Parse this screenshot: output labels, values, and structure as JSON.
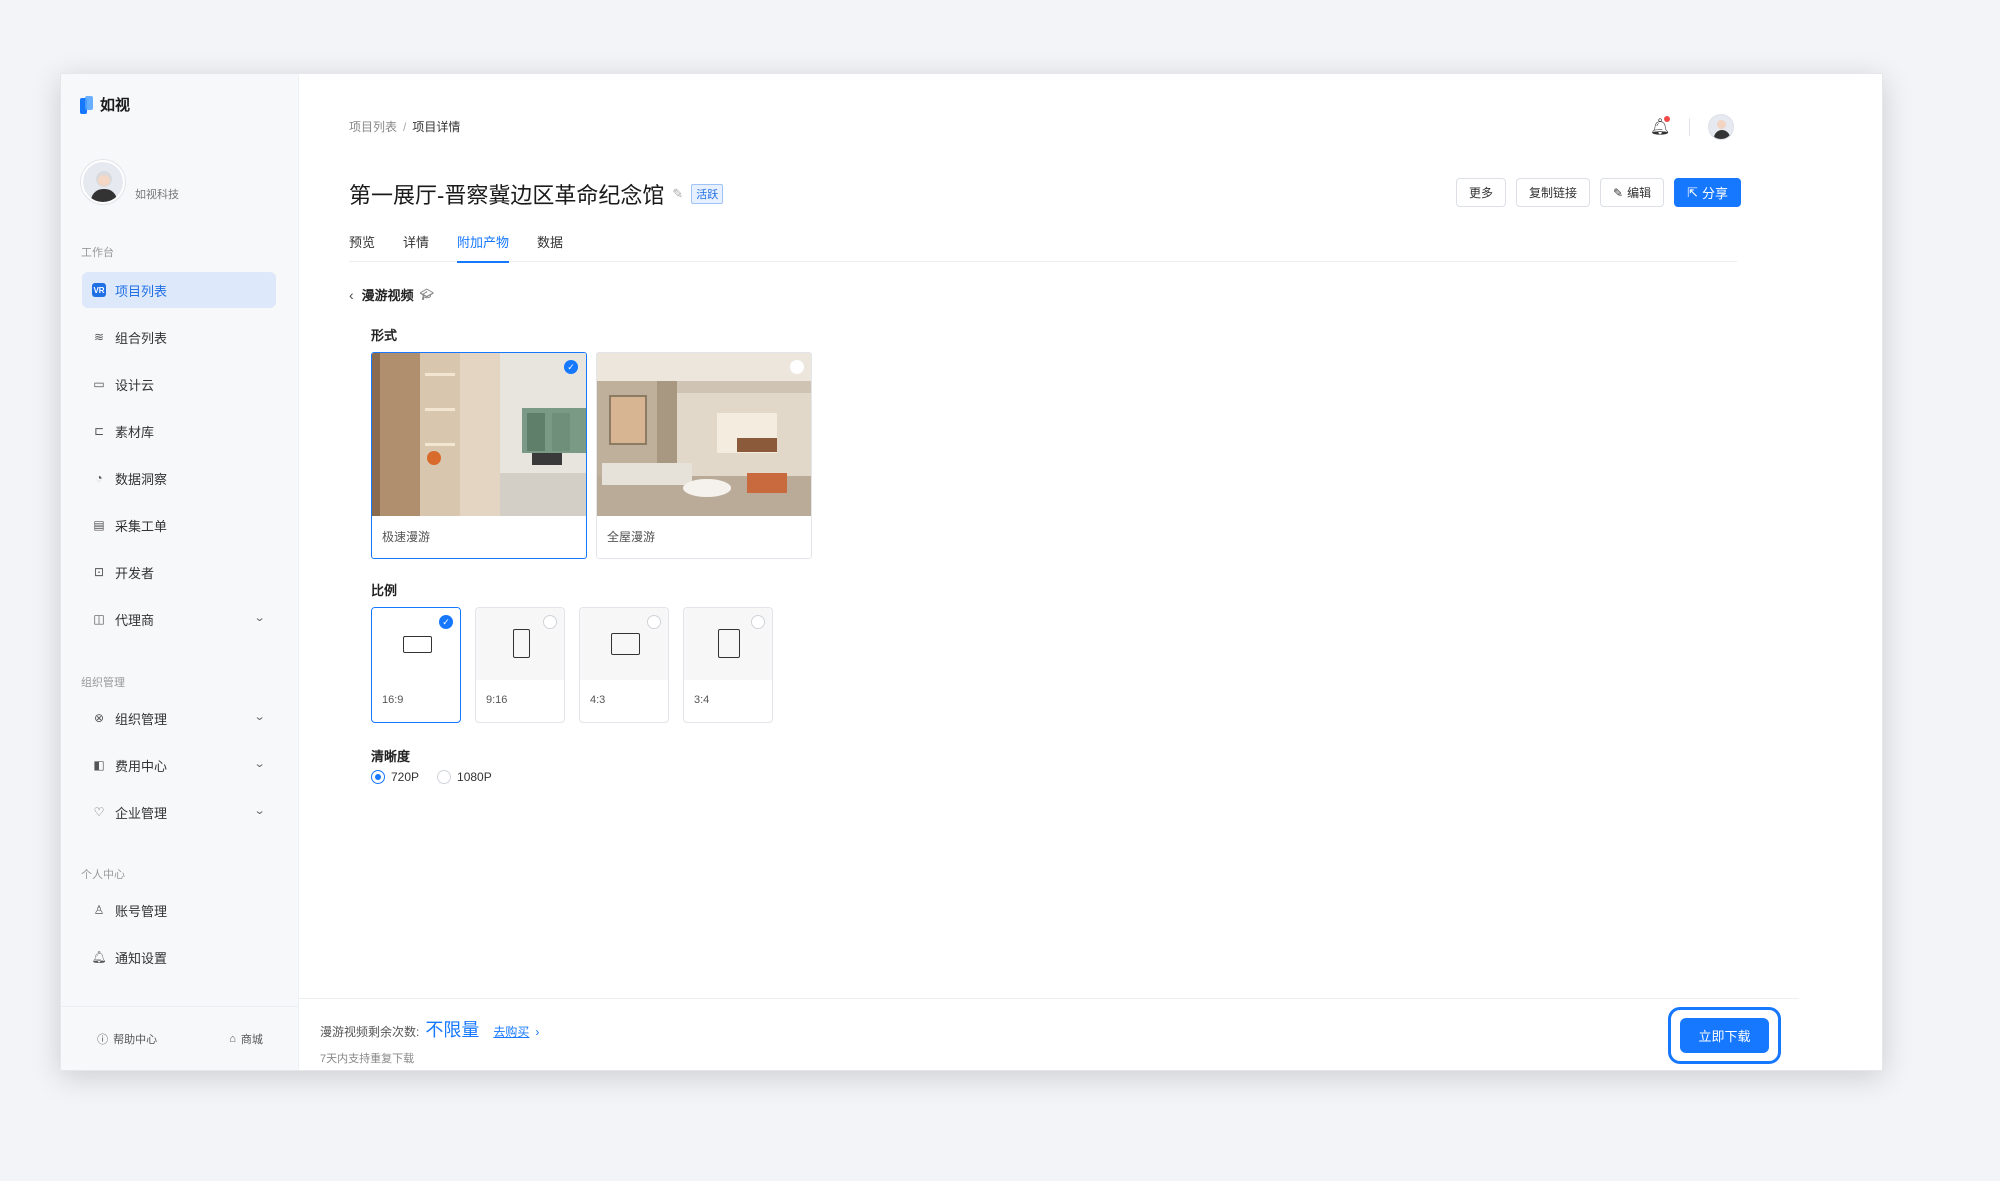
{
  "app": {
    "name": "如视"
  },
  "user": {
    "company": "如视科技"
  },
  "sidebar": {
    "groups": [
      {
        "title": "工作台",
        "items": [
          {
            "label": "项目列表",
            "icon": "vr-icon",
            "active": true
          },
          {
            "label": "组合列表",
            "icon": "layers-icon"
          },
          {
            "label": "设计云",
            "icon": "monitor-icon"
          },
          {
            "label": "素材库",
            "icon": "folder-icon"
          },
          {
            "label": "数据洞察",
            "icon": "pie-icon"
          },
          {
            "label": "采集工单",
            "icon": "form-icon"
          },
          {
            "label": "开发者",
            "icon": "code-icon"
          },
          {
            "label": "代理商",
            "icon": "briefcase-icon",
            "expandable": true
          }
        ]
      },
      {
        "title": "组织管理",
        "items": [
          {
            "label": "组织管理",
            "icon": "org-icon",
            "expandable": true
          },
          {
            "label": "费用中心",
            "icon": "wallet-icon",
            "expandable": true
          },
          {
            "label": "企业管理",
            "icon": "shield-icon",
            "expandable": true
          }
        ]
      },
      {
        "title": "个人中心",
        "items": [
          {
            "label": "账号管理",
            "icon": "user-icon"
          },
          {
            "label": "通知设置",
            "icon": "bell-icon"
          }
        ]
      }
    ],
    "footer": {
      "help": "帮助中心",
      "store": "商城"
    }
  },
  "breadcrumb": {
    "parent": "项目列表",
    "sep": "/",
    "current": "项目详情"
  },
  "page": {
    "title": "第一展厅-晋察冀边区革命纪念馆",
    "status": "活跃"
  },
  "actions": {
    "more": "更多",
    "copy_link": "复制链接",
    "edit": "编辑",
    "share": "分享"
  },
  "tabs": [
    "预览",
    "详情",
    "附加产物",
    "数据"
  ],
  "active_tab": "附加产物",
  "section": {
    "title": "漫游视频"
  },
  "form": {
    "style_label": "形式",
    "styles": [
      {
        "label": "极速漫游",
        "selected": true
      },
      {
        "label": "全屋漫游",
        "selected": false
      }
    ],
    "ratio_label": "比例",
    "ratios": [
      {
        "label": "16:9",
        "selected": true
      },
      {
        "label": "9:16",
        "selected": false
      },
      {
        "label": "4:3",
        "selected": false
      },
      {
        "label": "3:4",
        "selected": false
      }
    ],
    "quality_label": "清晰度",
    "qualities": [
      {
        "label": "720P",
        "selected": true
      },
      {
        "label": "1080P",
        "selected": false
      }
    ]
  },
  "bottom": {
    "remain_label": "漫游视频剩余次数:",
    "remain_value": "不限量",
    "buy": "去购买",
    "buy_arrow": "›",
    "note": "7天内支持重复下载",
    "download": "立即下载"
  },
  "colors": {
    "primary": "#1677ff",
    "active_nav_bg": "#dde9fb",
    "badge_border": "#9fc3f7",
    "notice_dot": "#f24a4a"
  }
}
